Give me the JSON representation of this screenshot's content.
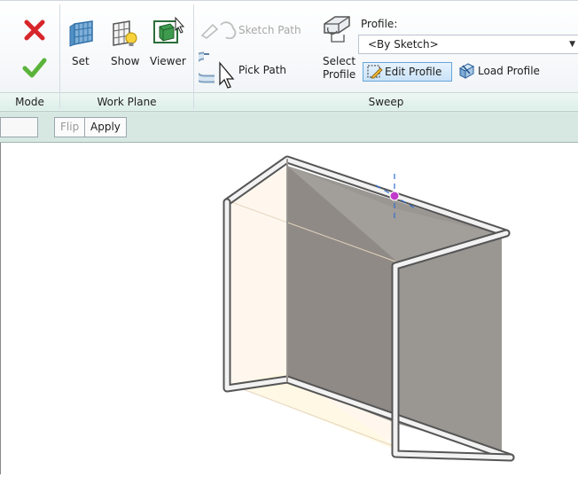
{
  "ribbon": {
    "mode": {
      "title": "Mode",
      "cancel_icon": "cancel-x-icon",
      "finish_icon": "finish-check-icon"
    },
    "work_plane": {
      "title": "Work Plane",
      "set_label": "Set",
      "show_label": "Show",
      "viewer_label": "Viewer"
    },
    "sweep": {
      "title": "Sweep",
      "sketch_path_label": "Sketch Path",
      "pick_path_label": "Pick Path",
      "select_profile_line1": "Select",
      "select_profile_line2": "Profile",
      "profile_caption": "Profile:",
      "profile_value": "<By Sketch>",
      "edit_profile_label": "Edit Profile",
      "load_profile_label": "Load Profile"
    }
  },
  "options_bar": {
    "flip_label": "Flip",
    "apply_label": "Apply"
  },
  "colors": {
    "cancel_red": "#d7262b",
    "finish_green": "#5bb43a",
    "panel_title_bg": "#dcefe8",
    "options_bar_bg": "#d7e8e2",
    "sweep_face": "#9a9692",
    "sweep_face_light": "#fff4e4",
    "control_point": "#c23ac9"
  }
}
